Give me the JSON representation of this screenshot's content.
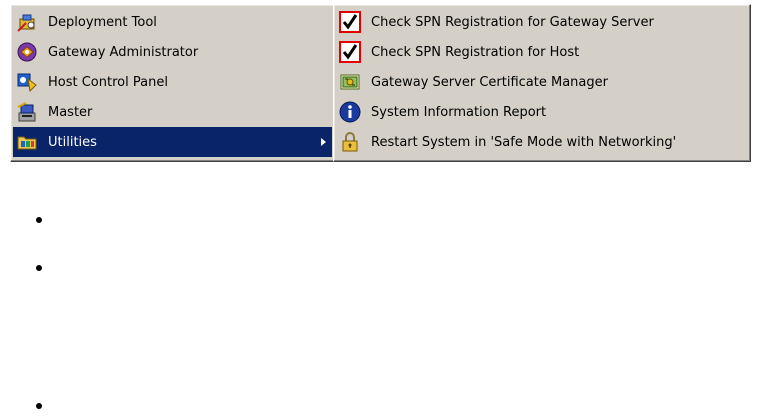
{
  "main_menu": {
    "items": [
      {
        "label": "Deployment Tool",
        "icon": "deployment-tool-icon"
      },
      {
        "label": "Gateway Administrator",
        "icon": "gateway-administrator-icon"
      },
      {
        "label": "Host Control Panel",
        "icon": "host-control-panel-icon"
      },
      {
        "label": "Master",
        "icon": "master-icon"
      },
      {
        "label": "Utilities",
        "icon": "utilities-folder-icon",
        "selected": true,
        "has_submenu": true
      }
    ]
  },
  "utilities_submenu": {
    "items": [
      {
        "label": "Check SPN Registration for Gateway Server",
        "icon": "checkmark-icon"
      },
      {
        "label": "Check SPN Registration for Host",
        "icon": "checkmark-icon"
      },
      {
        "label": "Gateway Server Certificate Manager",
        "icon": "certificate-icon"
      },
      {
        "label": "System Information Report",
        "icon": "info-icon"
      },
      {
        "label": "Restart System in 'Safe Mode with Networking'",
        "icon": "padlock-icon"
      }
    ]
  },
  "colors": {
    "menu_background": "#d4d0c8",
    "highlight_background": "#0a246a",
    "highlight_text": "#ffffff",
    "checkmark_frame": "#e00000"
  }
}
